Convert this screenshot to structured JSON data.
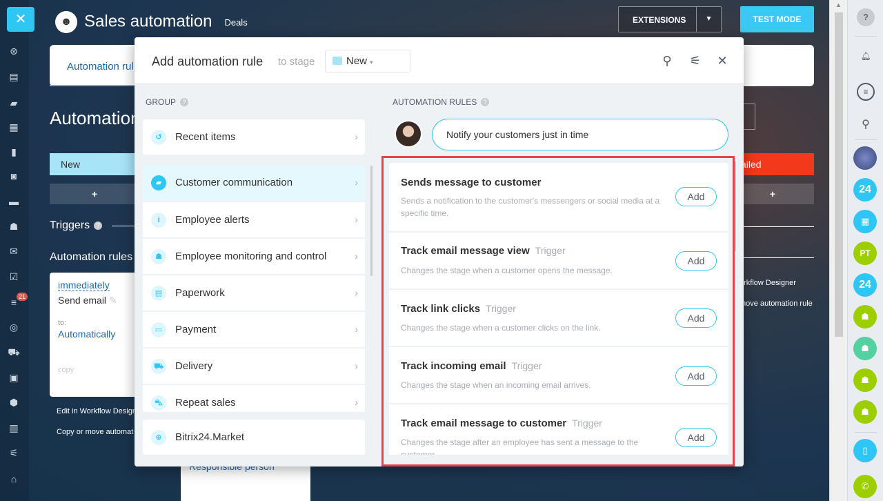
{
  "app": {
    "title": "Sales automation",
    "subtitle": "Deals",
    "extensions_label": "EXTENSIONS",
    "test_mode_label": "TEST MODE"
  },
  "background": {
    "tab_automation": "Automation rul",
    "heading": "Automation",
    "stage_new": "New",
    "plus": "+",
    "triggers": "Triggers",
    "automation_rules": "Automation rules",
    "card": {
      "when": "immediately",
      "action": "Send email",
      "to_label": "to:",
      "to_value": "Automatically",
      "copy": "copy"
    },
    "edit_in_designer": "Edit in Workflow Designe",
    "copy_or_move": "Copy or move automat",
    "stage_failed": "ailed",
    "plus_right": "+",
    "workflow_designer_right": "orkflow Designer",
    "move_rule_right": "move automation rule",
    "responsible_person": "Responsible person"
  },
  "modal": {
    "title": "Add automation rule",
    "to_stage": "to stage",
    "stage_value": "New",
    "group_label": "GROUP",
    "rules_label": "AUTOMATION RULES",
    "bubble": "Notify your customers just in time",
    "groups": [
      {
        "label": "Recent items",
        "icon": "history-icon"
      },
      {
        "label": "Customer communication",
        "icon": "chat-icon"
      },
      {
        "label": "Employee alerts",
        "icon": "info-icon"
      },
      {
        "label": "Employee monitoring and control",
        "icon": "users-icon"
      },
      {
        "label": "Paperwork",
        "icon": "document-icon"
      },
      {
        "label": "Payment",
        "icon": "wallet-icon"
      },
      {
        "label": "Delivery",
        "icon": "truck-icon"
      },
      {
        "label": "Repeat sales",
        "icon": "cart-icon"
      },
      {
        "label": "Bitrix24.Market",
        "icon": "market-icon"
      }
    ],
    "rules": [
      {
        "title": "Sends message to customer",
        "tag": "",
        "desc": "Sends a notification to the customer's messengers or social media at a specific time.",
        "add": "Add"
      },
      {
        "title": "Track email message view",
        "tag": "Trigger",
        "desc": "Changes the stage when a customer opens the message.",
        "add": "Add"
      },
      {
        "title": "Track link clicks",
        "tag": "Trigger",
        "desc": "Changes the stage when a customer clicks on the link.",
        "add": "Add"
      },
      {
        "title": "Track incoming email",
        "tag": "Trigger",
        "desc": "Changes the stage when an incoming email arrives.",
        "add": "Add"
      },
      {
        "title": "Track email message to customer",
        "tag": "Trigger",
        "desc": "Changes the stage after an employee has sent a message to the customer.",
        "add": "Add"
      }
    ]
  },
  "right_sidebar": {
    "avatar_pt": "PT",
    "b24a": "24",
    "b24b": "24"
  },
  "left_sidebar": {
    "badge": "21"
  }
}
